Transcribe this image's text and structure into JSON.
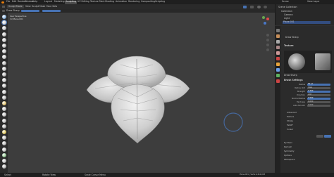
{
  "app": {
    "logo": "blender-logo-icon"
  },
  "menus": [
    "File",
    "Edit",
    "Render",
    "Window",
    "Help"
  ],
  "workspaces": [
    "Layout",
    "Modeling",
    "Sculpting",
    "UV Editing",
    "Texture Paint",
    "Shading",
    "Animation",
    "Rendering",
    "Compositing",
    "Scripting"
  ],
  "active_workspace": "Sculpting",
  "right_top": {
    "scene": "Scene",
    "layer": "View Layer"
  },
  "header": {
    "mode": "Sculpt Mode",
    "view": "View",
    "sculpt": "Sculpt",
    "mask": "Mask",
    "face_sets": "Face Sets"
  },
  "viewport": {
    "line1": "User Perspective",
    "line2": "(1) Plane.001",
    "accent": "#4772b3"
  },
  "outliner": {
    "title": "Scene Collection",
    "items": [
      "Collection",
      "Camera",
      "Light",
      "Plane.001"
    ]
  },
  "properties": {
    "brush_name": "Draw Sharp",
    "texture_label": "Texture",
    "new_texture": "Draw Sharp",
    "section_brush": "Brush Settings",
    "settings": [
      {
        "label": "Radius",
        "value": "50 px"
      },
      {
        "label": "Radius Unit",
        "value": "View"
      },
      {
        "label": "Strength",
        "value": "0.750"
      },
      {
        "label": "Direction",
        "value": "Add"
      },
      {
        "label": "Normal Radius",
        "value": "0.500"
      },
      {
        "label": "Hardness",
        "value": "0.000"
      },
      {
        "label": "Auto-Smooth",
        "value": "0.000"
      }
    ],
    "sections": [
      "Advanced",
      "Texture",
      "Stroke",
      "Falloff",
      "Cursor"
    ],
    "dyntopo": "Dyntopo",
    "remesh": "Remesh",
    "more_sections": [
      "Symmetry",
      "Options",
      "Workspace"
    ]
  },
  "status": {
    "left": "Select",
    "mid": "Rotate View",
    "right": "Scale Cursor Menu",
    "version": "Plane.001 | Verts:4,410,003"
  }
}
